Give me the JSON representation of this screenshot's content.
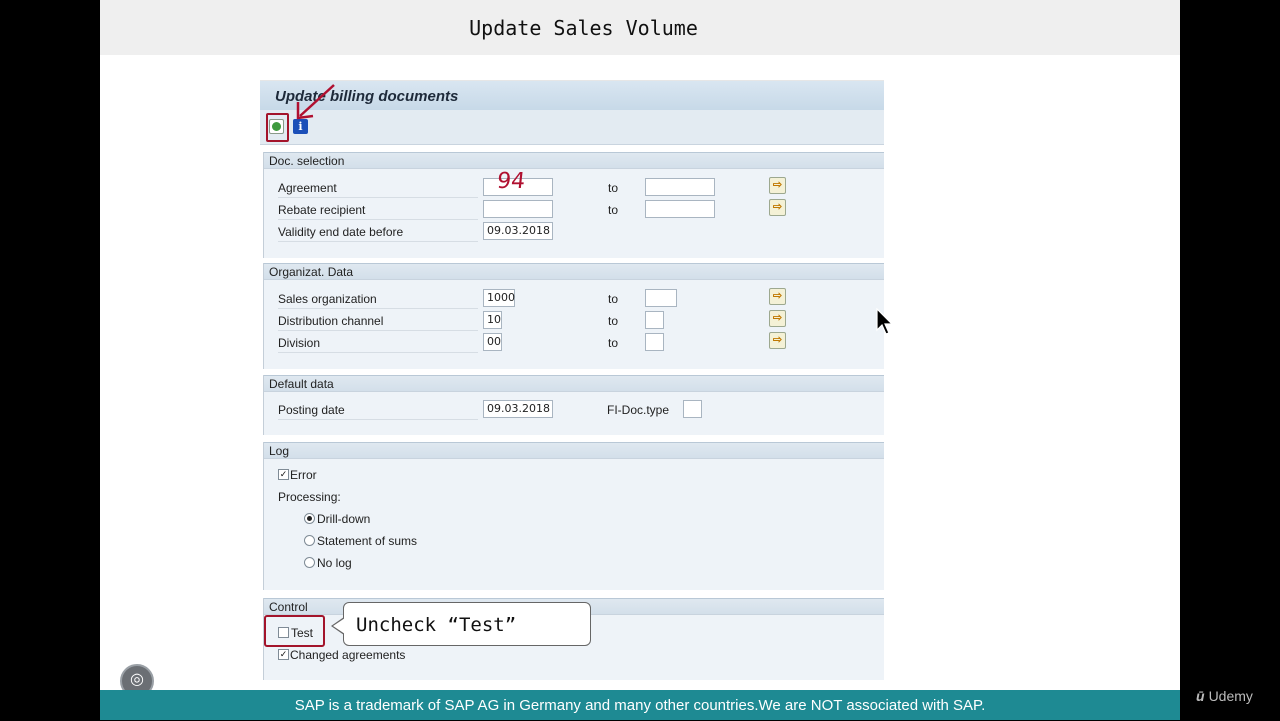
{
  "slide": {
    "title": "Update Sales Volume"
  },
  "sap": {
    "title": "Update billing documents",
    "annotation": "94",
    "doc_selection": {
      "header": "Doc. selection",
      "agreement_label": "Agreement",
      "rebate_label": "Rebate recipient",
      "validity_label": "Validity end date before",
      "validity_value": "09.03.2018",
      "to": "to"
    },
    "org_data": {
      "header": "Organizat. Data",
      "sales_org_label": "Sales organization",
      "sales_org_value": "1000",
      "dist_channel_label": "Distribution channel",
      "dist_channel_value": "10",
      "division_label": "Division",
      "division_value": "00",
      "to": "to"
    },
    "default_data": {
      "header": "Default data",
      "posting_label": "Posting date",
      "posting_value": "09.03.2018",
      "fidoc_label": "FI-Doc.type"
    },
    "log": {
      "header": "Log",
      "error_label": "Error",
      "error_check": "✓",
      "processing_label": "Processing:",
      "opt_drilldown": "Drill-down",
      "opt_sums": "Statement of sums",
      "opt_nolog": "No log"
    },
    "control": {
      "header": "Control",
      "test_label": "Test",
      "changed_label": "Changed agreements",
      "changed_check": "✓"
    },
    "more_icon": "⇨"
  },
  "callout": {
    "text": "Uncheck “Test”"
  },
  "footer": {
    "text": "SAP is a trademark of SAP AG in Germany and many other countries.We are NOT associated with SAP."
  },
  "brand": {
    "mark": "ū",
    "name": "Udemy"
  },
  "icons": [
    "execute-icon",
    "info-icon",
    "multiple-selection-icon",
    "mouse-cursor-icon"
  ],
  "colors": {
    "accent_red": "#a3142b",
    "footer_teal": "#1e8a93",
    "sap_blue": "#d3dfea"
  }
}
